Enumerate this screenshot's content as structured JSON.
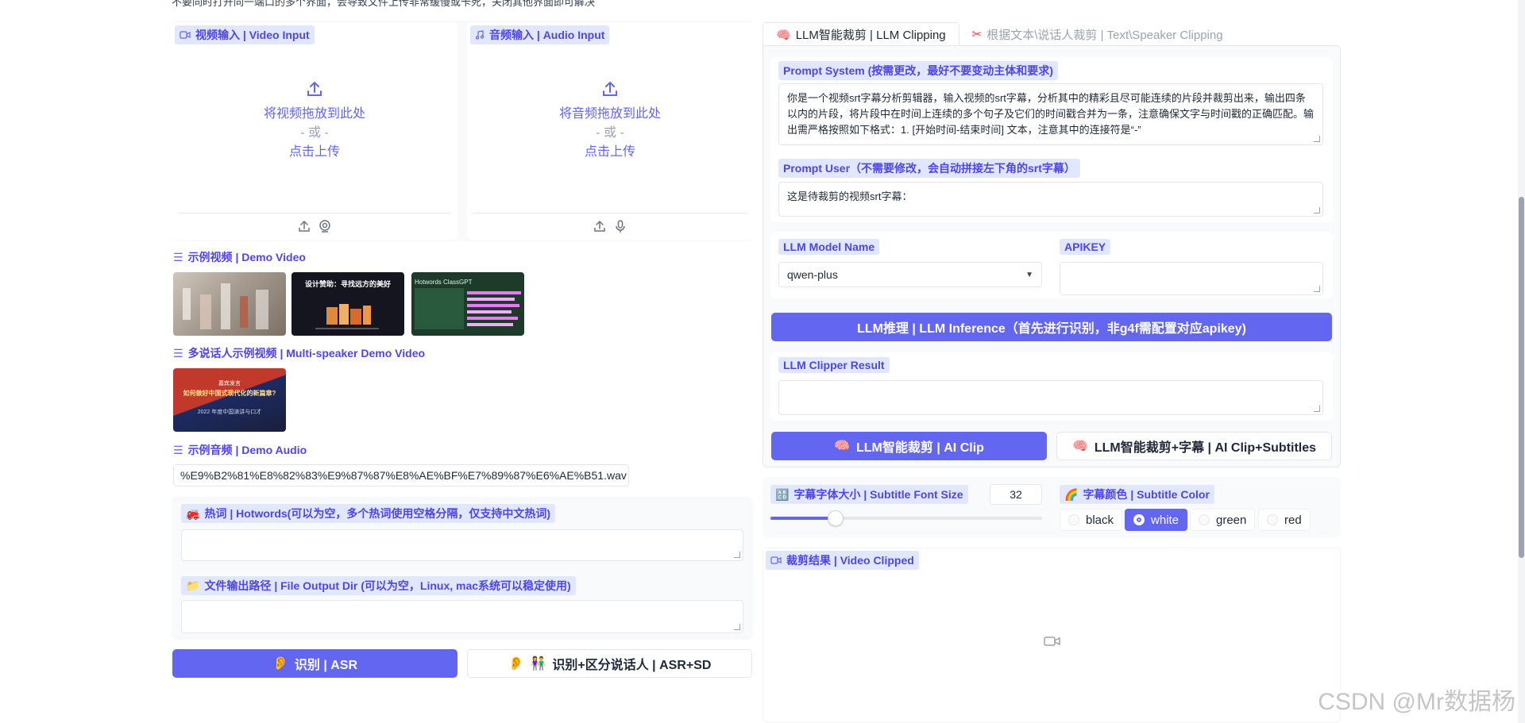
{
  "notice": "不要同时打开同一端口的多个界面，会导致文件上传非常缓慢或卡死，关闭其他界面即可解决",
  "video_input": {
    "label": "视频输入 | Video Input",
    "drop_text": "将视频拖放到此处",
    "or_text": "- 或 -",
    "click_text": "点击上传"
  },
  "audio_input": {
    "label": "音频输入 | Audio Input",
    "drop_text": "将音频拖放到此处",
    "or_text": "- 或 -",
    "click_text": "点击上传"
  },
  "demo_video": {
    "label": "示例视频 | Demo Video"
  },
  "multi_speaker_demo": {
    "label": "多说话人示例视频 | Multi-speaker Demo Video"
  },
  "thumb2": {
    "title": "设计赞助：寻找远方的美好"
  },
  "thumb3": {
    "title": "Hotwords ClassGPT"
  },
  "thumb4": {
    "line1": "嘉宾发言",
    "line2": "如何做好中国式现代化的新篇章?",
    "line3": "2022 年度中国演讲与口才"
  },
  "demo_audio": {
    "label": "示例音频 | Demo Audio",
    "file": "%E9%B2%81%E8%82%83%E9%87%87%E8%AE%BF%E7%89%87%E6%AE%B51.wav"
  },
  "hotwords": {
    "label": "热词 | Hotwords(可以为空，多个热词使用空格分隔，仅支持中文热词)",
    "value": ""
  },
  "output_dir": {
    "label": "文件输出路径 | File Output Dir (可以为空，Linux, mac系统可以稳定使用)",
    "value": ""
  },
  "buttons": {
    "asr": "识别 | ASR",
    "asr_sd": "识别+区分说话人 | ASR+SD",
    "llm_inference": "LLM推理 | LLM Inference（首先进行识别，非g4f需配置对应apikey)",
    "ai_clip": "LLM智能裁剪 | AI Clip",
    "ai_clip_subtitles": "LLM智能裁剪+字幕 | AI Clip+Subtitles"
  },
  "tabs": [
    {
      "label": "LLM智能裁剪 | LLM Clipping",
      "active": true
    },
    {
      "label": "根据文本\\说话人裁剪 | Text\\Speaker Clipping",
      "active": false
    }
  ],
  "prompt_system": {
    "label": "Prompt System (按需更改，最好不要变动主体和要求)",
    "value": "你是一个视频srt字幕分析剪辑器，输入视频的srt字幕，分析其中的精彩且尽可能连续的片段并裁剪出来，输出四条以内的片段，将片段中在时间上连续的多个句子及它们的时间戳合并为一条，注意确保文字与时间戳的正确匹配。输出需严格按照如下格式：1. [开始时间-结束时间] 文本，注意其中的连接符是“-”"
  },
  "prompt_user": {
    "label": "Prompt User（不需要修改，会自动拼接左下角的srt字幕）",
    "value": "这是待裁剪的视频srt字幕："
  },
  "llm_model": {
    "label": "LLM Model Name",
    "value": "qwen-plus"
  },
  "apikey": {
    "label": "APIKEY",
    "value": ""
  },
  "llm_result": {
    "label": "LLM Clipper Result",
    "value": ""
  },
  "subtitle_font": {
    "label": "字幕字体大小 | Subtitle Font Size",
    "value": "32",
    "fraction": 0.24
  },
  "subtitle_color": {
    "label": "字幕颜色 | Subtitle Color",
    "options": [
      "black",
      "white",
      "green",
      "red"
    ],
    "selected": "white"
  },
  "video_clipped": {
    "label": "裁剪结果 | Video Clipped"
  },
  "watermark": "CSDN @Mr数据杨",
  "colors": {
    "accent": "#6366f1",
    "tag_bg": "#e0e7ff",
    "tag_text": "#4f46e5"
  }
}
